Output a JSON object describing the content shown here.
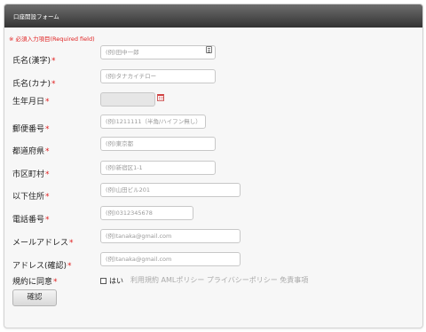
{
  "header": {
    "title": "口座開設フォーム"
  },
  "required_note": "※ 必須入力項目(Required field)",
  "required_mark": "*",
  "fields": [
    {
      "label": "氏名(漢字)",
      "placeholder": "(例)田中一郎"
    },
    {
      "label": "氏名(カナ)",
      "placeholder": "(例)タナカイチロー"
    },
    {
      "label": "生年月日",
      "placeholder": ""
    },
    {
      "label": "郵便番号",
      "placeholder": "(例)1211111（半角/ハイフン無し）"
    },
    {
      "label": "都道府県",
      "placeholder": "(例)東京都"
    },
    {
      "label": "市区町村",
      "placeholder": "(例)新宿区1-1"
    },
    {
      "label": "以下住所",
      "placeholder": "(例)山田ビル201"
    },
    {
      "label": "電話番号",
      "placeholder": "(例)0312345678"
    },
    {
      "label": "メールアドレス",
      "placeholder": "(例)tanaka@gmail.com"
    },
    {
      "label": "アドレス(確認)",
      "placeholder": "(例)tanaka@gmail.com"
    }
  ],
  "agreement": {
    "label": "規約に同意",
    "checkbox_label": "はい",
    "terms_text": "利用規約 AMLポリシー プライバシーポリシー 免責事項"
  },
  "submit_label": "確認",
  "icons": {
    "keyboard": "keyboard-icon",
    "calendar": "calendar-icon"
  },
  "colors": {
    "required": "#e02020",
    "header_top": "#6e6e6e",
    "header_bottom": "#333333"
  }
}
